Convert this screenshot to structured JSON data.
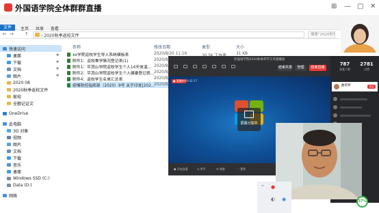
{
  "stream": {
    "title": "外国语学院全体群群直播",
    "controls": [
      "⊞",
      "—",
      "▢",
      "✕"
    ]
  },
  "ribbon": {
    "file_tab": "文件",
    "tabs": [
      "主页",
      "共享",
      "查看"
    ]
  },
  "address": {
    "nav": [
      "←",
      "→",
      "↑"
    ],
    "path": "› 2020秋季返校文件",
    "search_placeholder": "搜索\"2020秋季返校文件\""
  },
  "sidebar": {
    "items": [
      {
        "label": "快速访问",
        "color": "#3b8ee0",
        "pinned": false
      },
      {
        "label": "桌面",
        "color": "#3a9be8",
        "pinned": true
      },
      {
        "label": "下载",
        "color": "#3a9be8",
        "pinned": true
      },
      {
        "label": "文档",
        "color": "#6b8fb5",
        "pinned": true
      },
      {
        "label": "图片",
        "color": "#5aa0d8",
        "pinned": true
      },
      {
        "label": "2020 08",
        "color": "#e6b84a",
        "pinned": false
      },
      {
        "label": "2020秋季返校文件",
        "color": "#e6b84a",
        "pinned": false
      },
      {
        "label": "家校",
        "color": "#e6b84a",
        "pinned": false
      },
      {
        "label": "全额记证文",
        "color": "#e6b84a",
        "pinned": false
      },
      {
        "label": "OneDrive",
        "color": "#2b7cd3",
        "pinned": false
      },
      {
        "label": "此电脑",
        "color": "#4a90d9",
        "pinned": false
      },
      {
        "label": "3D 对象",
        "color": "#4fa3e0",
        "pinned": false
      },
      {
        "label": "视频",
        "color": "#6b7fa8",
        "pinned": false
      },
      {
        "label": "图片",
        "color": "#5aa0d8",
        "pinned": false
      },
      {
        "label": "文档",
        "color": "#6b8fb5",
        "pinned": false
      },
      {
        "label": "下载",
        "color": "#3a9be8",
        "pinned": false
      },
      {
        "label": "音乐",
        "color": "#5a8fd8",
        "pinned": false
      },
      {
        "label": "桌面",
        "color": "#3a9be8",
        "pinned": false
      },
      {
        "label": "Windows SSD (C:)",
        "color": "#7d8a99",
        "pinned": false
      },
      {
        "label": "Data (D:)",
        "color": "#7d8a99",
        "pinned": false
      },
      {
        "label": "网络",
        "color": "#4a90d9",
        "pinned": false
      }
    ]
  },
  "file_list": {
    "headers": {
      "name": "名称",
      "modified": "修改日期",
      "type": "类型",
      "size": "大小"
    },
    "files": [
      {
        "name": "xx学院返校学生导入系统模板表",
        "modified": "2020/8/20 11:16",
        "type": "30.5K 工作表",
        "size": "31 KB"
      },
      {
        "name": "附件1：返校秉学情况登记表(1)",
        "modified": "2020/8/20",
        "type": "",
        "size": ""
      },
      {
        "name": "附件1：平顶山学院返校学生个人14天体温...",
        "modified": "2020/8/20",
        "type": "",
        "size": ""
      },
      {
        "name": "附件2：平顶山学院返校学生个人健康登记表...",
        "modified": "2020/8/",
        "type": "",
        "size": ""
      },
      {
        "name": "附件4：返校学生名单汇总表",
        "modified": "2020/8/",
        "type": "",
        "size": ""
      },
      {
        "name": "疫情防控指挥部（2020）9号 关于印发[202...",
        "modified": "2020/8/",
        "type": "",
        "size": ""
      }
    ]
  },
  "remote_window": {
    "title": "外国语学院2020秋季开学工作直播会",
    "rec_badge": "● 直播中",
    "rec_time": "00:42:17",
    "share_label": "屏幕分享中",
    "btn_stop_share": "结束共享",
    "btn_settings": "管理",
    "btn_end": "结束直播",
    "bottom_items": [
      "● 开启连麦",
      "◎ 举手",
      "☰ 课堂",
      "⋯ 更多"
    ]
  },
  "panel": {
    "stats": [
      {
        "num": "787",
        "label": "观看人数"
      },
      {
        "num": "2781",
        "label": "点赞"
      }
    ],
    "host_name": "曲老师",
    "follow": "关注"
  },
  "tray": {
    "icons": [
      "⌃",
      "●",
      "◐",
      "◉"
    ]
  },
  "cpu": {
    "value": "37%",
    "fraction": 0.37
  },
  "colors": {
    "accent": "#1a73c8",
    "live_red": "#e53935",
    "panel_bg": "#26272b"
  }
}
